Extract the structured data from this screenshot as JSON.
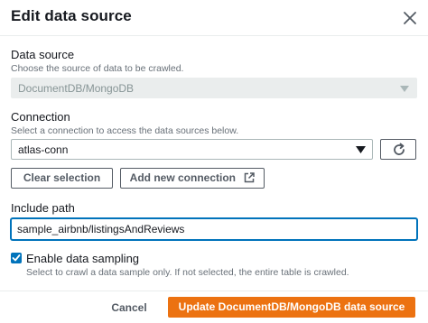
{
  "modal": {
    "title": "Edit data source"
  },
  "data_source": {
    "label": "Data source",
    "description": "Choose the source of data to be crawled.",
    "selected": "DocumentDB/MongoDB"
  },
  "connection": {
    "label": "Connection",
    "description": "Select a connection to access the data sources below.",
    "selected": "atlas-conn",
    "clear_label": "Clear selection",
    "add_label": "Add new connection"
  },
  "include_path": {
    "label": "Include path",
    "value": "sample_airbnb/listingsAndReviews"
  },
  "sampling": {
    "label": "Enable data sampling",
    "description": "Select to crawl a data sample only. If not selected, the entire table is crawled.",
    "checked": true
  },
  "footer": {
    "cancel_label": "Cancel",
    "submit_label": "Update DocumentDB/MongoDB data source"
  },
  "colors": {
    "primary": "#ec7211",
    "focus": "#0073bb",
    "text": "#16191f",
    "muted": "#687078"
  }
}
